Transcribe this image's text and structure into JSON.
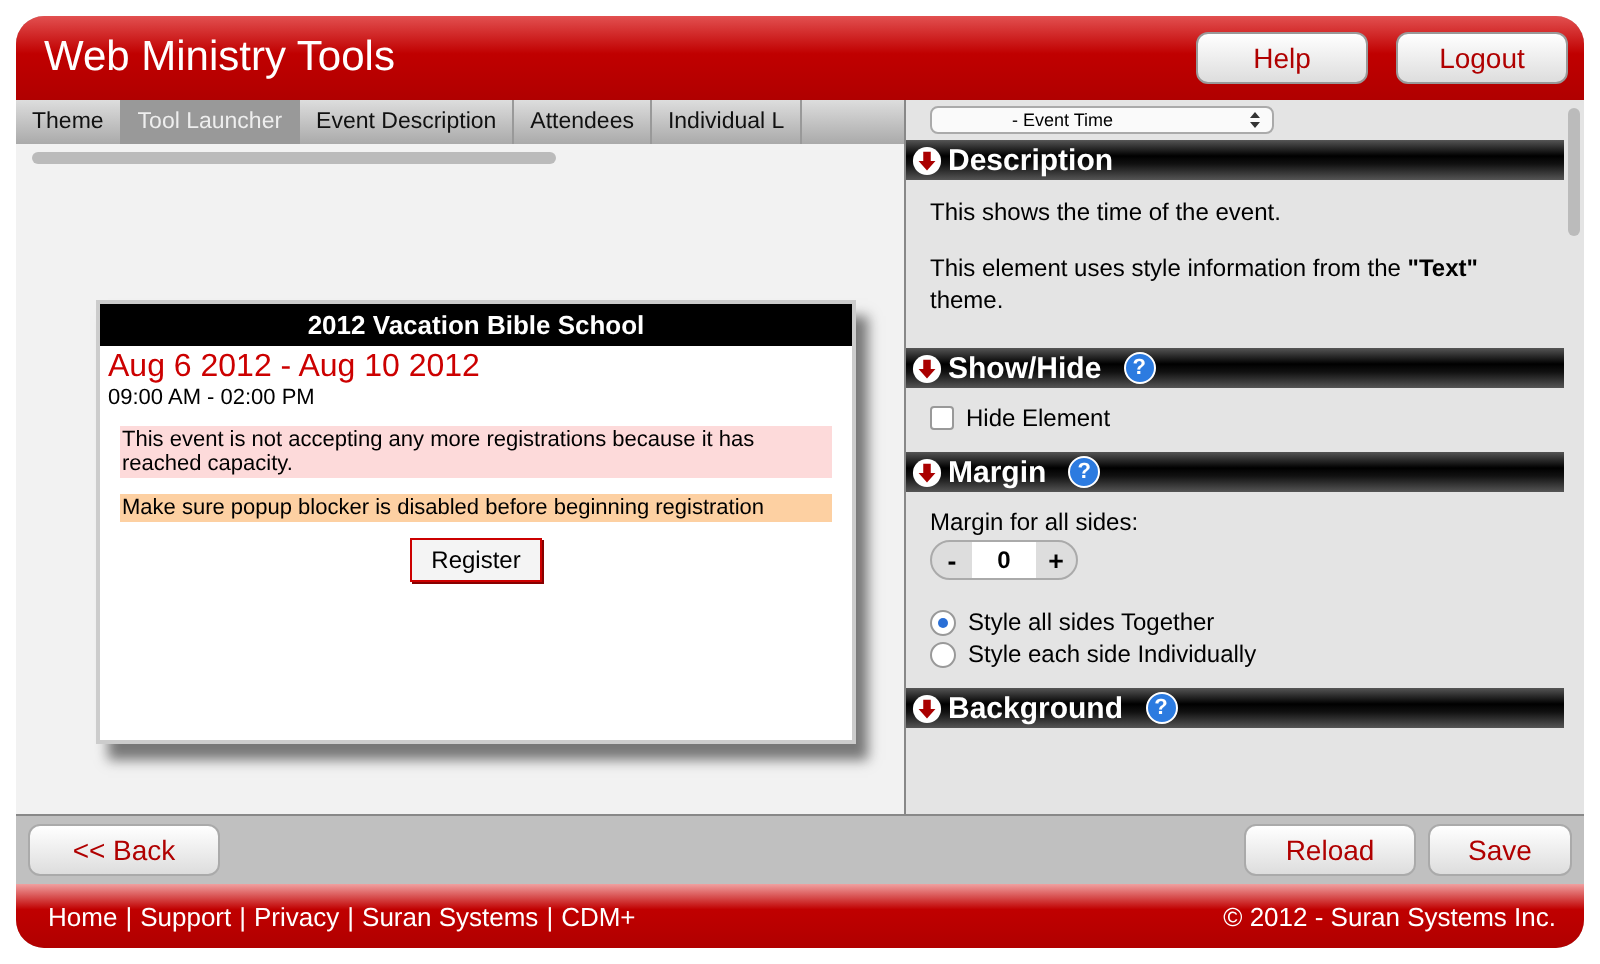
{
  "header": {
    "title": "Web Ministry Tools",
    "buttons": [
      "Help",
      "Logout"
    ]
  },
  "tabs": [
    {
      "label": "Theme",
      "selected": false
    },
    {
      "label": "Tool Launcher",
      "selected": true
    },
    {
      "label": "Event Description",
      "selected": false
    },
    {
      "label": "Attendees",
      "selected": false
    },
    {
      "label": "Individual L",
      "selected": false
    }
  ],
  "preview": {
    "title": "2012 Vacation Bible School",
    "dates": "Aug 6 2012 - Aug 10 2012",
    "time": "09:00 AM - 02:00 PM",
    "notices": [
      {
        "kind": "error",
        "text": "This event is not accepting any more registrations because it has reached capacity."
      },
      {
        "kind": "warning",
        "text": "Make sure popup blocker is disabled before beginning registration"
      }
    ],
    "button": "Register"
  },
  "properties": {
    "element_select": "- Event Time",
    "sections": [
      {
        "title": "Description",
        "kind": "text",
        "paragraphs": [
          "This shows the time of the event.",
          "This element uses style information from the **\"Text\"** theme."
        ]
      },
      {
        "title": "Show/Hide",
        "help": "?",
        "kind": "checkbox",
        "label": "Hide Element",
        "checked": false
      },
      {
        "title": "Margin",
        "help": "?",
        "kind": "margin",
        "label": "Margin for all sides:",
        "minus": "-",
        "value": "0",
        "plus": "+",
        "options": [
          {
            "label": "Style all sides Together",
            "selected": true
          },
          {
            "label": "Style each side Individually",
            "selected": false
          }
        ]
      },
      {
        "title": "Background",
        "help": "?",
        "kind": "empty"
      }
    ]
  },
  "toolbar": {
    "back": "<< Back",
    "buttons": [
      "Reload",
      "Save"
    ]
  },
  "footer": {
    "links": [
      "Home",
      "Support",
      "Privacy",
      "Suran Systems",
      "CDM+"
    ],
    "separator": "|",
    "copyright": "© 2012 - Suran Systems Inc."
  }
}
